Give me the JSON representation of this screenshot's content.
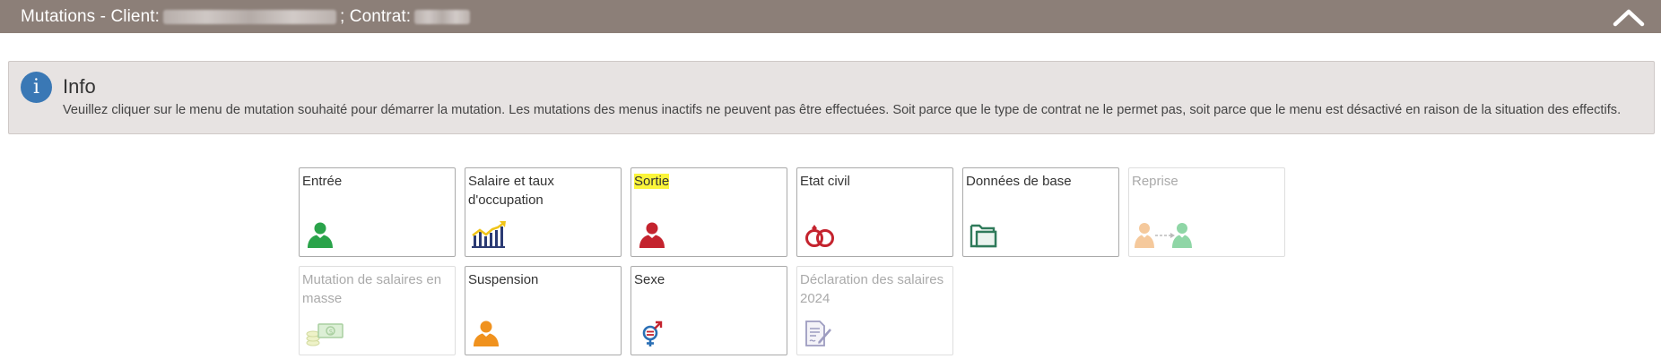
{
  "header": {
    "title_prefix": "Mutations - Client:",
    "title_mid": "; Contrat:",
    "collapse_icon": "chevron-up-icon"
  },
  "info": {
    "icon": "info-icon",
    "icon_glyph": "i",
    "title": "Info",
    "text": "Veuillez cliquer sur le menu de mutation souhaité pour démarrer la mutation. Les mutations des menus inactifs ne peuvent pas être effectuées. Soit parce que le type de contrat ne le permet pas, soit parce que le menu est désactivé en raison de la situation des effectifs."
  },
  "tiles": [
    {
      "label": "Entrée",
      "icon": "person-green-icon",
      "enabled": true
    },
    {
      "label": "Salaire et taux d'occupation",
      "icon": "salary-chart-icon",
      "enabled": true
    },
    {
      "label": "Sortie",
      "icon": "person-red-icon",
      "enabled": true,
      "highlighted": true
    },
    {
      "label": "Etat civil",
      "icon": "rings-icon",
      "enabled": true
    },
    {
      "label": "Données de base",
      "icon": "folder-icon",
      "enabled": true
    },
    {
      "label": "Reprise",
      "icon": "transfer-persons-icon",
      "enabled": false
    },
    {
      "label": "Mutation de salaires en masse",
      "icon": "money-stack-icon",
      "enabled": false
    },
    {
      "label": "Suspension",
      "icon": "person-orange-icon",
      "enabled": true
    },
    {
      "label": "Sexe",
      "icon": "gender-icon",
      "enabled": true
    },
    {
      "label": "Déclaration des salaires 2024",
      "icon": "document-sign-icon",
      "enabled": false
    }
  ],
  "colors": {
    "header_bg": "#8c7f78",
    "info_bg": "#e7e3e2",
    "info_icon": "#3a78b5",
    "highlight": "#fbf53a"
  }
}
